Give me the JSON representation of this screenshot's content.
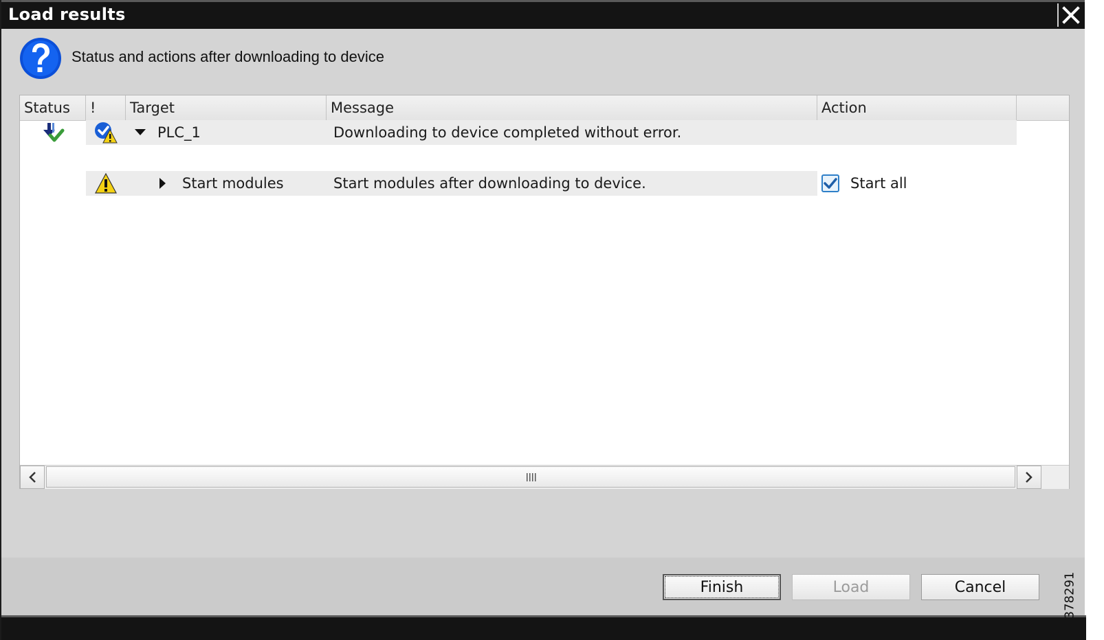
{
  "window": {
    "title": "Load results",
    "close_icon": "close-icon"
  },
  "header": {
    "icon": "question-icon",
    "text": "Status and actions after downloading to device"
  },
  "table": {
    "columns": [
      "Status",
      "!",
      "Target",
      "Message",
      "Action"
    ],
    "rows": [
      {
        "status_icon": "download-success-icon",
        "alert_icon": "check-warning-icon",
        "expander": "expanded",
        "target": "PLC_1",
        "message": "Downloading to device completed without error.",
        "action": ""
      },
      {
        "status_icon": "",
        "alert_icon": "warning-icon",
        "expander": "collapsed",
        "target": "Start modules",
        "message": "Start modules after downloading to device.",
        "action": {
          "checked": true,
          "label": "Start all"
        }
      }
    ]
  },
  "buttons": {
    "finish": "Finish",
    "load": "Load",
    "cancel": "Cancel"
  },
  "watermark": "378291",
  "colors": {
    "titlebar": "#141414",
    "dialog_bg": "#d4d4d4",
    "accent_blue": "#1a5fd6",
    "warning_yellow": "#f5d214",
    "success_green": "#3a9c3a"
  }
}
